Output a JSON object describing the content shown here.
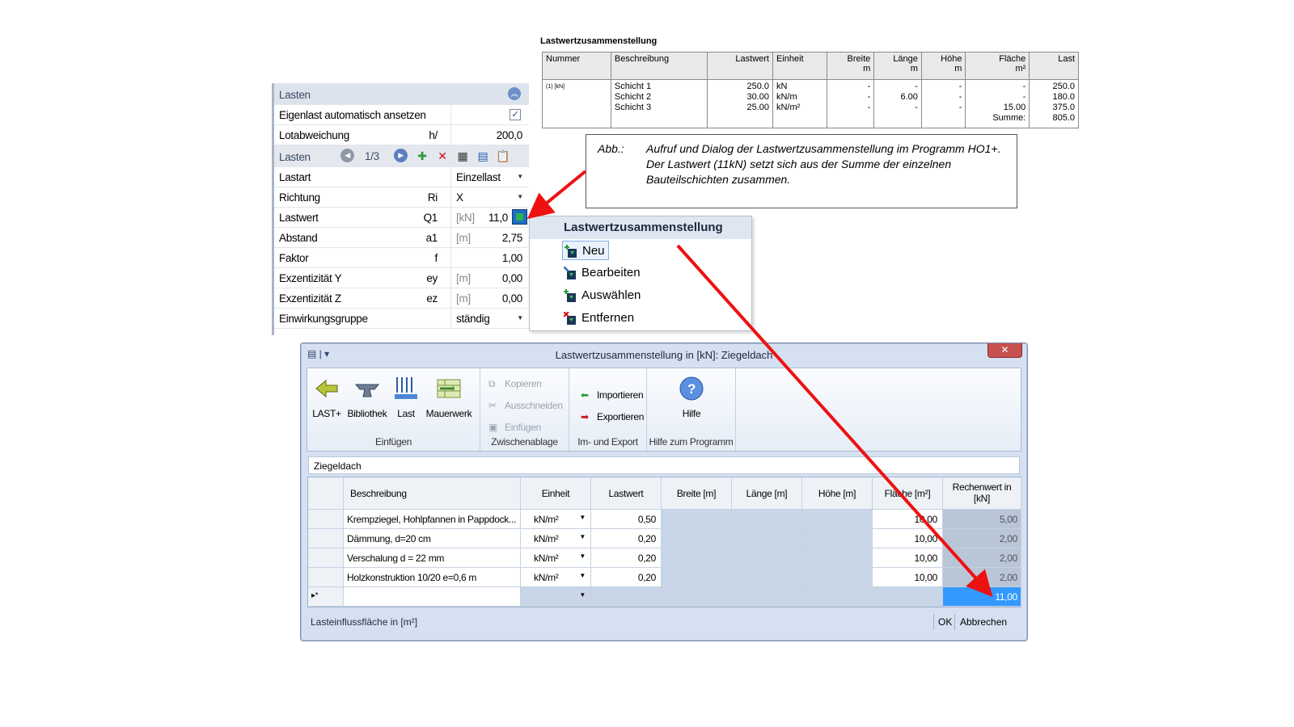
{
  "report": {
    "title": "Lastwertzusammenstellung",
    "headers": {
      "nummer": "Nummer",
      "beschreibung": "Beschreibung",
      "lastwert": "Lastwert",
      "einheit": "Einheit",
      "breite": "Breite",
      "breite_unit": "m",
      "laenge": "Länge",
      "laenge_unit": "m",
      "hoehe": "Höhe",
      "hoehe_unit": "m",
      "flaeche": "Fläche",
      "flaeche_unit": "m²",
      "last": "Last"
    },
    "row": {
      "nummer": "(1) [kN]",
      "beschreibung": [
        "Schicht 1",
        "Schicht 2",
        "Schicht 3"
      ],
      "lastwert": [
        "250.0",
        "30.00",
        "25.00"
      ],
      "einheit": [
        "kN",
        "kN/m",
        "kN/m²"
      ],
      "breite": [
        "-",
        "-",
        "-"
      ],
      "laenge": [
        "-",
        "6.00",
        "-"
      ],
      "hoehe": [
        "-",
        "-",
        "-"
      ],
      "flaeche": [
        "-",
        "-",
        "15.00",
        "Summe:"
      ],
      "last": [
        "250.0",
        "180.0",
        "375.0",
        "805.0"
      ]
    }
  },
  "caption": {
    "label": "Abb.:",
    "text": "Aufruf und Dialog der Lastwertzusammenstellung im Programm HO1+. Der Lastwert (11kN) setzt sich aus der Summe der einzelnen Bauteilschichten zusammen."
  },
  "panel": {
    "section_title": "Lasten",
    "eigenlast_label": "Eigenlast automatisch ansetzen",
    "eigenlast_checked": true,
    "lotabweichung_label": "Lotabweichung",
    "lotabweichung_sym": "h/",
    "lotabweichung_value": "200,0",
    "lasten_label": "Lasten",
    "lasten_counter": "1/3",
    "rows": [
      {
        "label": "Lastart",
        "sym": "",
        "unit": "",
        "value": "Einzellast",
        "dropdown": true
      },
      {
        "label": "Richtung",
        "sym": "Ri",
        "unit": "",
        "value": "X",
        "dropdown": true
      },
      {
        "label": "Lastwert",
        "sym": "Q1",
        "unit": "[kN]",
        "value": "11,0"
      },
      {
        "label": "Abstand",
        "sym": "a1",
        "unit": "[m]",
        "value": "2,75"
      },
      {
        "label": "Faktor",
        "sym": "f",
        "unit": "",
        "value": "1,00"
      },
      {
        "label": "Exzentizität Y",
        "sym": "ey",
        "unit": "[m]",
        "value": "0,00"
      },
      {
        "label": "Exzentizität Z",
        "sym": "ez",
        "unit": "[m]",
        "value": "0,00"
      },
      {
        "label": "Einwirkungsgruppe",
        "sym": "",
        "unit": "",
        "value": "ständig",
        "dropdown": true
      }
    ]
  },
  "context_menu": {
    "title": "Lastwertzusammenstellung",
    "items": [
      "Neu",
      "Bearbeiten",
      "Auswählen",
      "Entfernen"
    ]
  },
  "dialog": {
    "title": "Lastwertzusammenstellung in [kN]: Ziegeldach",
    "close": "✕",
    "ribbon": {
      "einfuegen": {
        "buttons": [
          "LAST+",
          "Bibliothek",
          "Last",
          "Mauerwerk"
        ],
        "label": "Einfügen"
      },
      "zwischenablage": {
        "buttons": [
          "Kopieren",
          "Ausschneiden",
          "Einfügen"
        ],
        "label": "Zwischenablage"
      },
      "imexport": {
        "buttons": [
          "Importieren",
          "Exportieren"
        ],
        "label": "Im- und Export"
      },
      "hilfe": {
        "buttons": [
          "Hilfe"
        ],
        "label": "Hilfe zum Programm"
      }
    },
    "name_value": "Ziegeldach",
    "columns": [
      "Beschreibung",
      "Einheit",
      "Lastwert",
      "Breite [m]",
      "Länge [m]",
      "Höhe [m]",
      "Fläche [m²]",
      "Rechenwert in [kN]"
    ],
    "rows": [
      {
        "beschreibung": "Krempziegel, Hohlpfannen in Pappdock...",
        "einheit": "kN/m²",
        "lastwert": "0,50",
        "flaeche": "10,00",
        "rechenwert": "5,00"
      },
      {
        "beschreibung": "Dämmung, d=20 cm",
        "einheit": "kN/m²",
        "lastwert": "0,20",
        "flaeche": "10,00",
        "rechenwert": "2,00"
      },
      {
        "beschreibung": "Verschalung d = 22 mm",
        "einheit": "kN/m²",
        "lastwert": "0,20",
        "flaeche": "10,00",
        "rechenwert": "2,00"
      },
      {
        "beschreibung": "Holzkonstruktion 10/20 e=0,6 m",
        "einheit": "kN/m²",
        "lastwert": "0,20",
        "flaeche": "10,00",
        "rechenwert": "2,00"
      }
    ],
    "new_row_marker": "▸*",
    "sum": "11,00",
    "status": "Lasteinflussfläche in [m²]",
    "ok": "OK",
    "cancel": "Abbrechen"
  },
  "colors": {
    "arrow": "#ee1111",
    "selection": "#3399ff",
    "panel_header": "#dde3ec"
  }
}
